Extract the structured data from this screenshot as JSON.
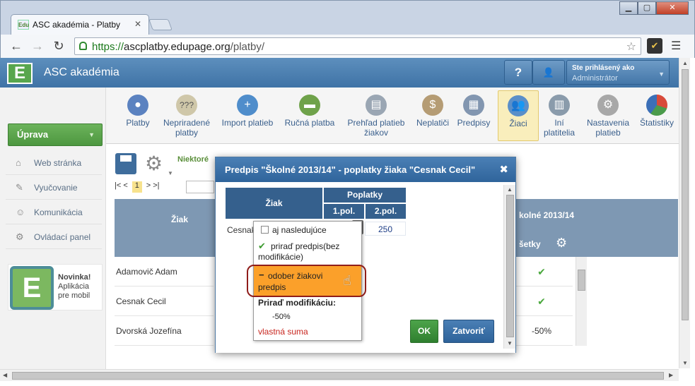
{
  "browser": {
    "tab_title": "ASC akadémia - Platby",
    "tab_favicon_text": "Edu",
    "url_scheme": "https://",
    "url_host": "ascplatby.edupage.org",
    "url_path": "/platby/"
  },
  "app": {
    "logo_letter": "E",
    "title": "ASC akadémia",
    "help_label": "?",
    "user_line1": "Ste prihlásený ako",
    "user_line2": "Administrátor"
  },
  "ribbon": {
    "items": [
      {
        "label": "Platby"
      },
      {
        "label": "Nepriradené platby"
      },
      {
        "label": "Import platieb"
      },
      {
        "label": "Ručná platba"
      },
      {
        "label": "Prehľad platieb žiakov"
      },
      {
        "label": "Neplatiči"
      },
      {
        "label": "Predpisy"
      },
      {
        "label": "Žiaci"
      },
      {
        "label": "Iní platitelia"
      },
      {
        "label": "Nastavenia platieb"
      },
      {
        "label": "Štatistiky"
      }
    ]
  },
  "sidebar": {
    "action_button": "Úprava",
    "items": [
      {
        "label": "Web stránka"
      },
      {
        "label": "Vyučovanie"
      },
      {
        "label": "Komunikácia"
      },
      {
        "label": "Ovládací panel"
      }
    ],
    "promo_title": "Novinka!",
    "promo_line2": "Aplikácia",
    "promo_line3": "pre mobil"
  },
  "main": {
    "notice_partial": "Niektoré",
    "pager_first": "|< <",
    "pager_current": "1",
    "pager_next": "> >|",
    "col_student": "Žiak",
    "col_right_header": "kolné 2013/14",
    "col_right_sub": "šetky",
    "rows": [
      {
        "name": "Adamovič Adam",
        "right": "✔"
      },
      {
        "name": "Cesnak Cecil",
        "right": "✔"
      },
      {
        "name": "Dvorská Jozefína",
        "right": "-50%"
      }
    ]
  },
  "dialog": {
    "title": "Predpis \"Školné 2013/14\" - poplatky žiaka \"Cesnak Cecil\"",
    "close_glyph": "✖",
    "table": {
      "col_student": "Žiak",
      "group_header": "Poplatky",
      "sub1": "1.pol.",
      "sub2": "2.pol.",
      "row_name": "Cesnak",
      "row_val2": "250"
    },
    "ok_label": "OK",
    "close_label": "Zatvoriť"
  },
  "menu": {
    "opt_also_following": "aj nasledujúce",
    "opt_assign": "priraď predpis(bez modifikácie)",
    "opt_remove": "odober žiakovi predpis",
    "opt_modif_header": "Priraď modifikáciu:",
    "opt_minus50": "-50%",
    "opt_custom": "vlastná suma"
  },
  "colors": {
    "header_blue": "#3f73a6",
    "accent_green": "#4d9740",
    "highlight_orange": "#fba02a",
    "annotation_red": "#8f1d1a"
  }
}
